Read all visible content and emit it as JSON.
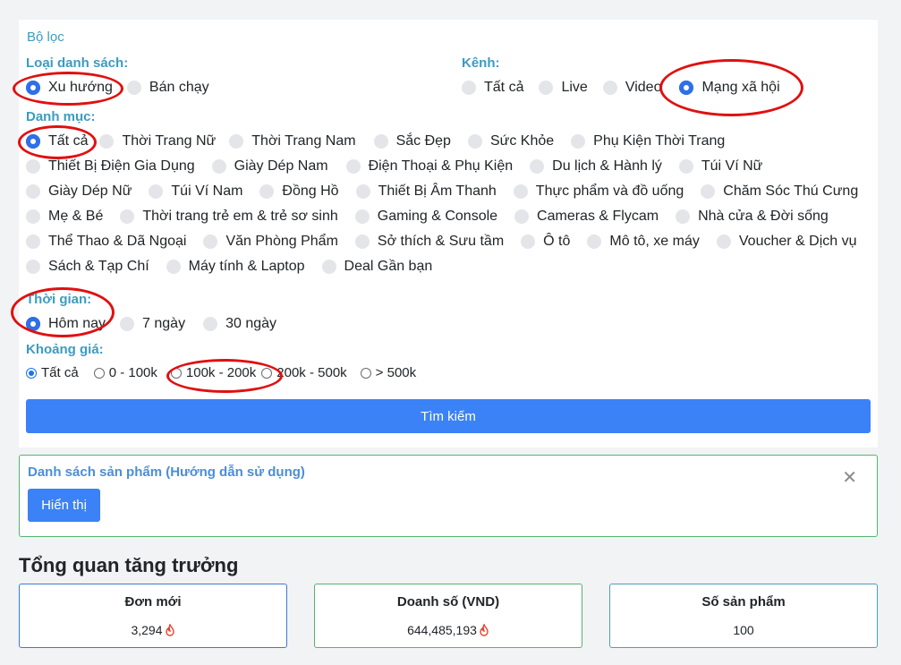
{
  "filter": {
    "title": "Bộ lọc",
    "list_type": {
      "label": "Loại danh sách:",
      "options": [
        "Xu hướng",
        "Bán chạy"
      ]
    },
    "channel": {
      "label": "Kênh:",
      "options": [
        "Tất cả",
        "Live",
        "Video",
        "Mạng xã hội"
      ]
    },
    "category": {
      "label": "Danh mục:",
      "rows": [
        [
          "Tất cả",
          "Thời Trang Nữ",
          "Thời Trang Nam",
          "Sắc Đẹp",
          "Sức Khỏe",
          "Phụ Kiện Thời Trang"
        ],
        [
          "Thiết Bị Điện Gia Dụng",
          "Giày Dép Nam",
          "Điện Thoại & Phụ Kiện",
          "Du lịch & Hành lý",
          "Túi Ví Nữ"
        ],
        [
          "Giày Dép Nữ",
          "Túi Ví Nam",
          "Đồng Hồ",
          "Thiết Bị Âm Thanh",
          "Thực phẩm và đồ uống",
          "Chăm Sóc Thú Cưng"
        ],
        [
          "Mẹ & Bé",
          "Thời trang trẻ em & trẻ sơ sinh",
          "Gaming & Console",
          "Cameras & Flycam",
          "Nhà cửa & Đời sống"
        ],
        [
          "Thể Thao & Dã Ngoại",
          "Văn Phòng Phẩm",
          "Sở thích & Sưu tầm",
          "Ô tô",
          "Mô tô, xe máy",
          "Voucher & Dịch vụ"
        ],
        [
          "Sách & Tạp Chí",
          "Máy tính & Laptop",
          "Deal Gần bạn"
        ]
      ]
    },
    "time": {
      "label": "Thời gian:",
      "options": [
        "Hôm nay",
        "7 ngày",
        "30 ngày"
      ]
    },
    "price": {
      "label": "Khoảng giá:",
      "options": [
        "Tất cả",
        "0 - 100k",
        "100k - 200k",
        "200k - 500k",
        "> 500k"
      ]
    },
    "search_label": "Tìm kiếm"
  },
  "product_list": {
    "title": "Danh sách sản phẩm (Hướng dẫn sử dụng)",
    "show_label": "Hiển thị",
    "close_glyph": "✕"
  },
  "overview": {
    "title": "Tổng quan tăng trưởng",
    "stats": [
      {
        "label": "Đơn mới",
        "value": "3,294",
        "hot": true
      },
      {
        "label": "Doanh số (VND)",
        "value": "644,485,193",
        "hot": true
      },
      {
        "label": "Số sản phẩm",
        "value": "100",
        "hot": false
      }
    ]
  },
  "colors": {
    "accent": "#3b82f6",
    "label_teal": "#3d9bbf",
    "annotation_red": "#e01010",
    "flame": "#e8412c"
  }
}
